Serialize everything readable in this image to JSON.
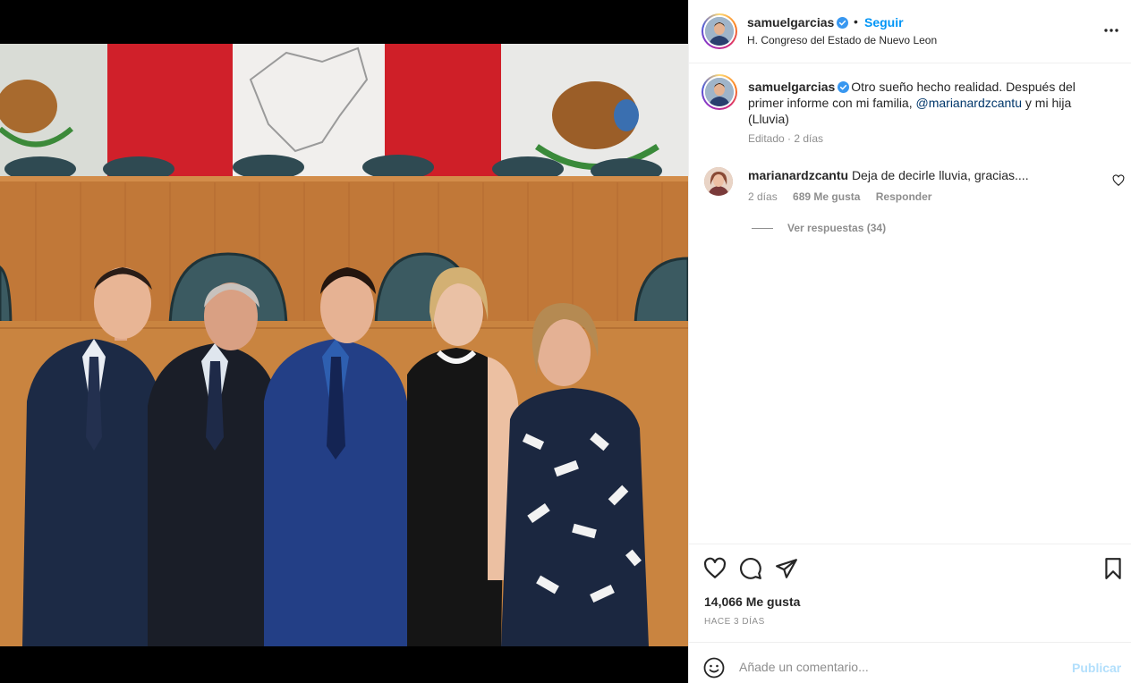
{
  "post": {
    "photo_alt": "Family photo at H. Congreso del Estado de Nuevo Leon"
  },
  "header": {
    "username": "samuelgarcias",
    "separator": "•",
    "follow_label": "Seguir",
    "location": "H. Congreso del Estado de Nuevo Leon",
    "more_icon": "more-horizontal-icon"
  },
  "caption": {
    "username": "samuelgarcias",
    "text_before": "Otro sueño hecho realidad. Después del primer informe con mi familia, ",
    "mention": "@marianardzcantu",
    "text_after": " y mi hija (Lluvia)",
    "meta": "Editado · 2 días"
  },
  "comment": {
    "username": "marianardzcantu",
    "text": "Deja de decirle lluvia, gracias....",
    "time": "2 días",
    "likes": "689 Me gusta",
    "reply_label": "Responder",
    "view_replies": "Ver respuestas (34)"
  },
  "actions": {
    "likes_total": "14,066 Me gusta",
    "time_ago": "HACE 3 DÍAS",
    "icons": [
      "heart-icon",
      "comment-icon",
      "share-icon",
      "bookmark-icon"
    ]
  },
  "add_comment": {
    "placeholder": "Añade un comentario...",
    "publish_label": "Publicar"
  },
  "colors": {
    "link_blue": "#0095f6",
    "mention_blue": "#00376b",
    "muted": "#8e8e8e",
    "publish_disabled": "#b2dffc"
  }
}
